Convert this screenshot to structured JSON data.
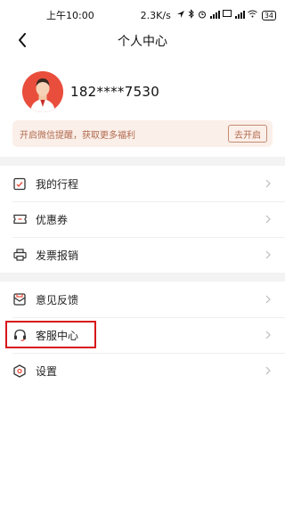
{
  "status_bar": {
    "time": "上午10:00",
    "network_speed": "2.3K/s",
    "battery": "34"
  },
  "header": {
    "title": "个人中心"
  },
  "profile": {
    "phone": "182****7530"
  },
  "wechat_banner": {
    "text": "开启微信提醒，获取更多福利",
    "button_label": "去开启"
  },
  "menu_group_1": [
    {
      "label": "我的行程",
      "icon": "itinerary-icon"
    },
    {
      "label": "优惠券",
      "icon": "coupon-icon"
    },
    {
      "label": "发票报销",
      "icon": "printer-icon"
    }
  ],
  "menu_group_2": [
    {
      "label": "意见反馈",
      "icon": "feedback-icon"
    },
    {
      "label": "客服中心",
      "icon": "headset-icon"
    },
    {
      "label": "设置",
      "icon": "settings-icon"
    }
  ],
  "colors": {
    "accent": "#e94e3c",
    "highlight": "#d8141a",
    "banner_bg": "#fbefe9",
    "banner_text": "#b06a4e"
  }
}
